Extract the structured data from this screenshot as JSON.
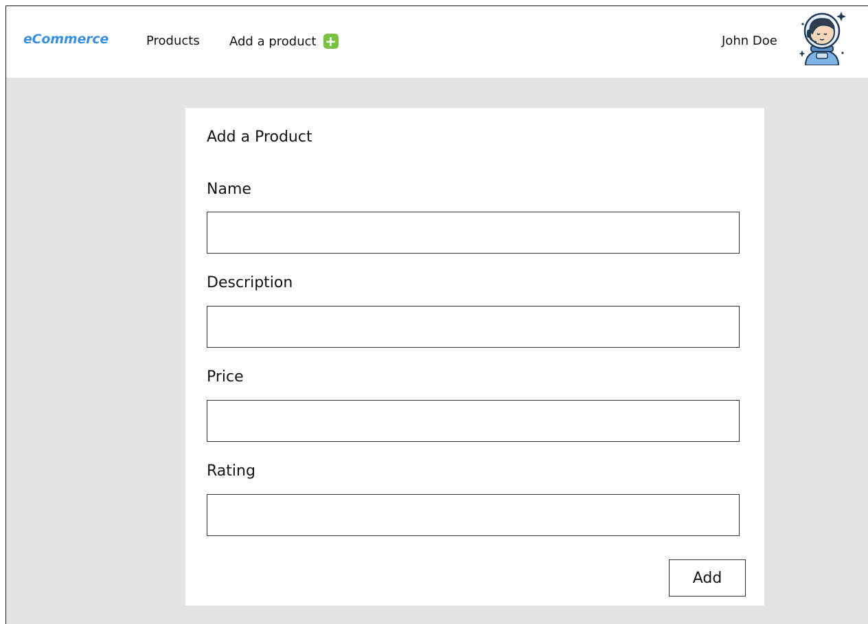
{
  "navbar": {
    "brand": "eCommerce",
    "links": [
      {
        "label": "Products"
      },
      {
        "label": "Add a product"
      }
    ],
    "user_name": "John Doe",
    "accent_color": "#3b8fe3",
    "add_icon_color": "#7ac142",
    "add_icon": "plus-icon",
    "avatar_icon": "astronaut-avatar-icon"
  },
  "form": {
    "title": "Add a Product",
    "fields": [
      {
        "label": "Name",
        "value": "",
        "placeholder": ""
      },
      {
        "label": "Description",
        "value": "",
        "placeholder": ""
      },
      {
        "label": "Price",
        "value": "",
        "placeholder": ""
      },
      {
        "label": "Rating",
        "value": "",
        "placeholder": ""
      }
    ],
    "submit_label": "Add"
  }
}
